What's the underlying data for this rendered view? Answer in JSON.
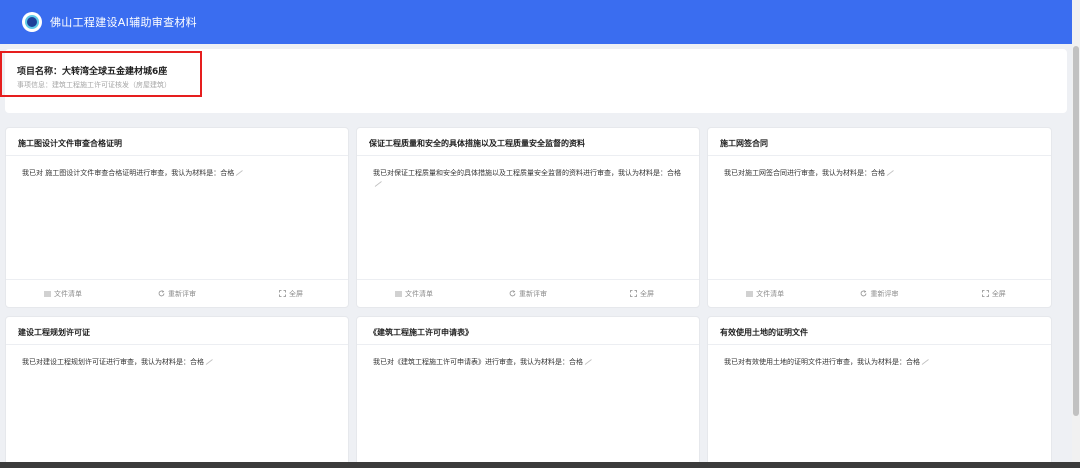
{
  "header": {
    "title": "佛山工程建设AI辅助审查材料",
    "logo_icon": "globe-logo",
    "background": "#3a6df0"
  },
  "project": {
    "name": "项目名称：大转湾全球五金建材城6座",
    "info": "事项信息：建筑工程施工许可证核发（房屋建筑）"
  },
  "footer_actions": {
    "file_list": "文件清单",
    "re_review": "重新评审",
    "fullscreen": "全屏"
  },
  "cards": [
    {
      "title": "施工图设计文件审查合格证明",
      "text": "我已对 施工图设计文件审查合格证明进行审查，我认为材料是：合格"
    },
    {
      "title": "保证工程质量和安全的具体措施以及工程质量安全监督的资料",
      "text": "我已对保证工程质量和安全的具体措施以及工程质量安全监督的资料进行审查，我认为材料是：合格"
    },
    {
      "title": "施工网签合同",
      "text": "我已对施工网签合同进行审查，我认为材料是：合格"
    },
    {
      "title": "建设工程规划许可证",
      "text": "我已对建设工程规划许可证进行审查，我认为材料是：合格"
    },
    {
      "title": "《建筑工程施工许可申请表》",
      "text": "我已对《建筑工程施工许可申请表》进行审查，我认为材料是：合格"
    },
    {
      "title": "有效使用土地的证明文件",
      "text": "我已对有效使用土地的证明文件进行审查，我认为材料是：合格"
    }
  ]
}
